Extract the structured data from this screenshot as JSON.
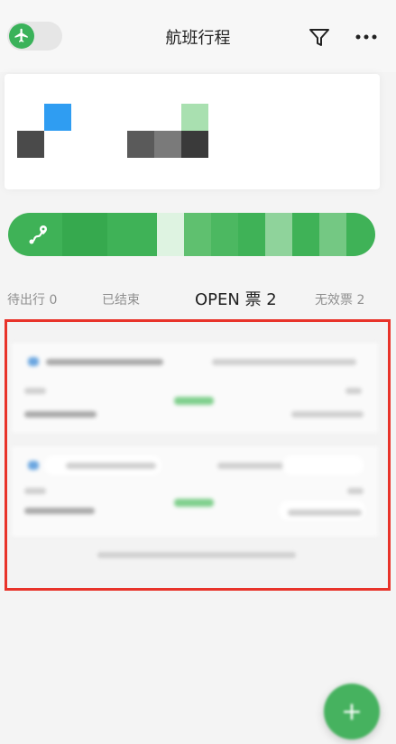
{
  "header": {
    "title": "航班行程",
    "toggle_icon": "airplane-icon",
    "filter_icon": "filter-icon",
    "more_icon": "more-icon"
  },
  "banner": {
    "icon": "route-pin-icon"
  },
  "tabs": [
    {
      "label": "待出行 0",
      "active": false
    },
    {
      "label": "已结束",
      "active": false
    },
    {
      "label": "OPEN 票 2",
      "active": true
    },
    {
      "label": "无效票 2",
      "active": false
    }
  ],
  "fab": {
    "label": "+"
  },
  "colors": {
    "brand_green": "#3fb257",
    "highlight_red": "#e8332a",
    "tab_active": "#1f1f1f",
    "tab_inactive": "#8f8f8f"
  }
}
